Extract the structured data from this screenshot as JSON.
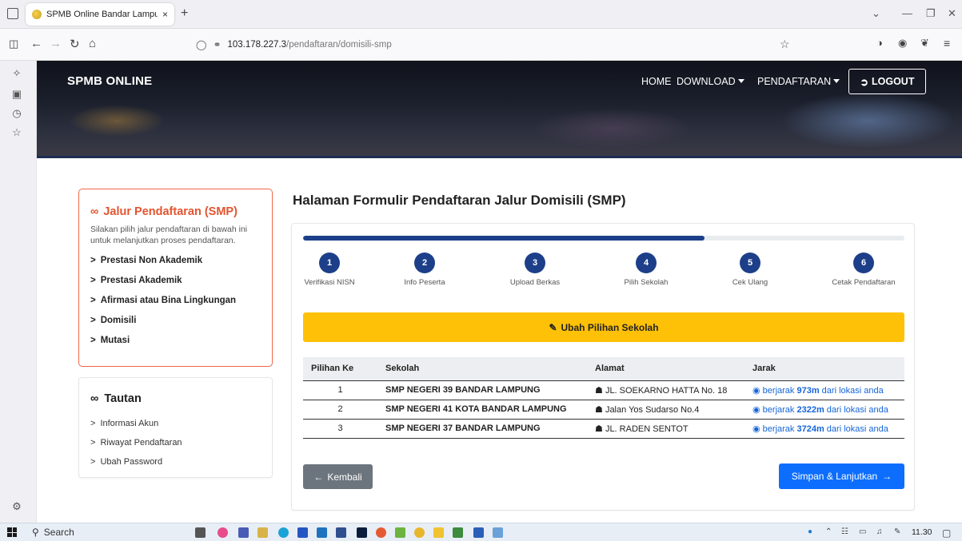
{
  "browser": {
    "tab_title": "SPMB Online Bandar Lampung",
    "tab_close": "×",
    "new_tab": "+",
    "url_host": "103.178.227.3",
    "url_path": "/pendaftaran/domisili-smp"
  },
  "site": {
    "brand": "SPMB ONLINE",
    "menu": {
      "home": "HOME",
      "download": "DOWNLOAD",
      "pendaftaran": "PENDAFTARAN",
      "logout": "LOGOUT"
    }
  },
  "jalur_card": {
    "title": "Jalur Pendaftaran (SMP)",
    "description": "Silakan pilih jalur pendaftaran di bawah ini untuk melanjutkan proses pendaftaran.",
    "items": [
      {
        "label": "Prestasi Non Akademik"
      },
      {
        "label": "Prestasi Akademik"
      },
      {
        "label": "Afirmasi atau Bina Lingkungan"
      },
      {
        "label": "Domisili"
      },
      {
        "label": "Mutasi"
      }
    ]
  },
  "tautan_card": {
    "title": "Tautan",
    "items": [
      {
        "label": "Informasi Akun"
      },
      {
        "label": "Riwayat Pendaftaran"
      },
      {
        "label": "Ubah Password"
      }
    ]
  },
  "main": {
    "title": "Halaman Formulir Pendaftaran Jalur Domisili (SMP)",
    "progress_fraction": 0.667,
    "steps": [
      {
        "num": "1",
        "label": "Verifikasi NISN"
      },
      {
        "num": "2",
        "label": "Info Peserta"
      },
      {
        "num": "3",
        "label": "Upload Berkas"
      },
      {
        "num": "4",
        "label": "Pilih Sekolah"
      },
      {
        "num": "5",
        "label": "Cek Ulang"
      },
      {
        "num": "6",
        "label": "Cetak Pendaftaran"
      }
    ],
    "ubah_button": "Ubah Pilihan Sekolah",
    "table": {
      "headers": [
        "Pilihan Ke",
        "Sekolah",
        "Alamat",
        "Jarak"
      ],
      "rows": [
        {
          "no": "1",
          "sekolah": "SMP NEGERI 39 BANDAR LAMPUNG",
          "alamat": "JL. SOEKARNO HATTA No. 18",
          "jarak_prefix": "berjarak ",
          "jarak_value": "973m",
          "jarak_suffix": " dari lokasi anda"
        },
        {
          "no": "2",
          "sekolah": "SMP NEGERI 41 KOTA BANDAR LAMPUNG",
          "alamat": "Jalan Yos Sudarso No.4",
          "jarak_prefix": "berjarak ",
          "jarak_value": "2322m",
          "jarak_suffix": " dari lokasi anda"
        },
        {
          "no": "3",
          "sekolah": "SMP NEGERI 37 BANDAR LAMPUNG",
          "alamat": "JL. RADEN SENTOT",
          "jarak_prefix": "berjarak ",
          "jarak_value": "3724m",
          "jarak_suffix": " dari lokasi anda"
        }
      ]
    },
    "kembali_button": "Kembali",
    "simpan_button": "Simpan & Lanjutkan"
  },
  "taskbar": {
    "search": "Search",
    "time": "11.30"
  },
  "colors": {
    "primary_navy": "#1d3f8a",
    "accent_orange": "#e3542f",
    "warning_yellow": "#ffc107",
    "primary_blue": "#0d6efd",
    "secondary_gray": "#6c757d"
  }
}
